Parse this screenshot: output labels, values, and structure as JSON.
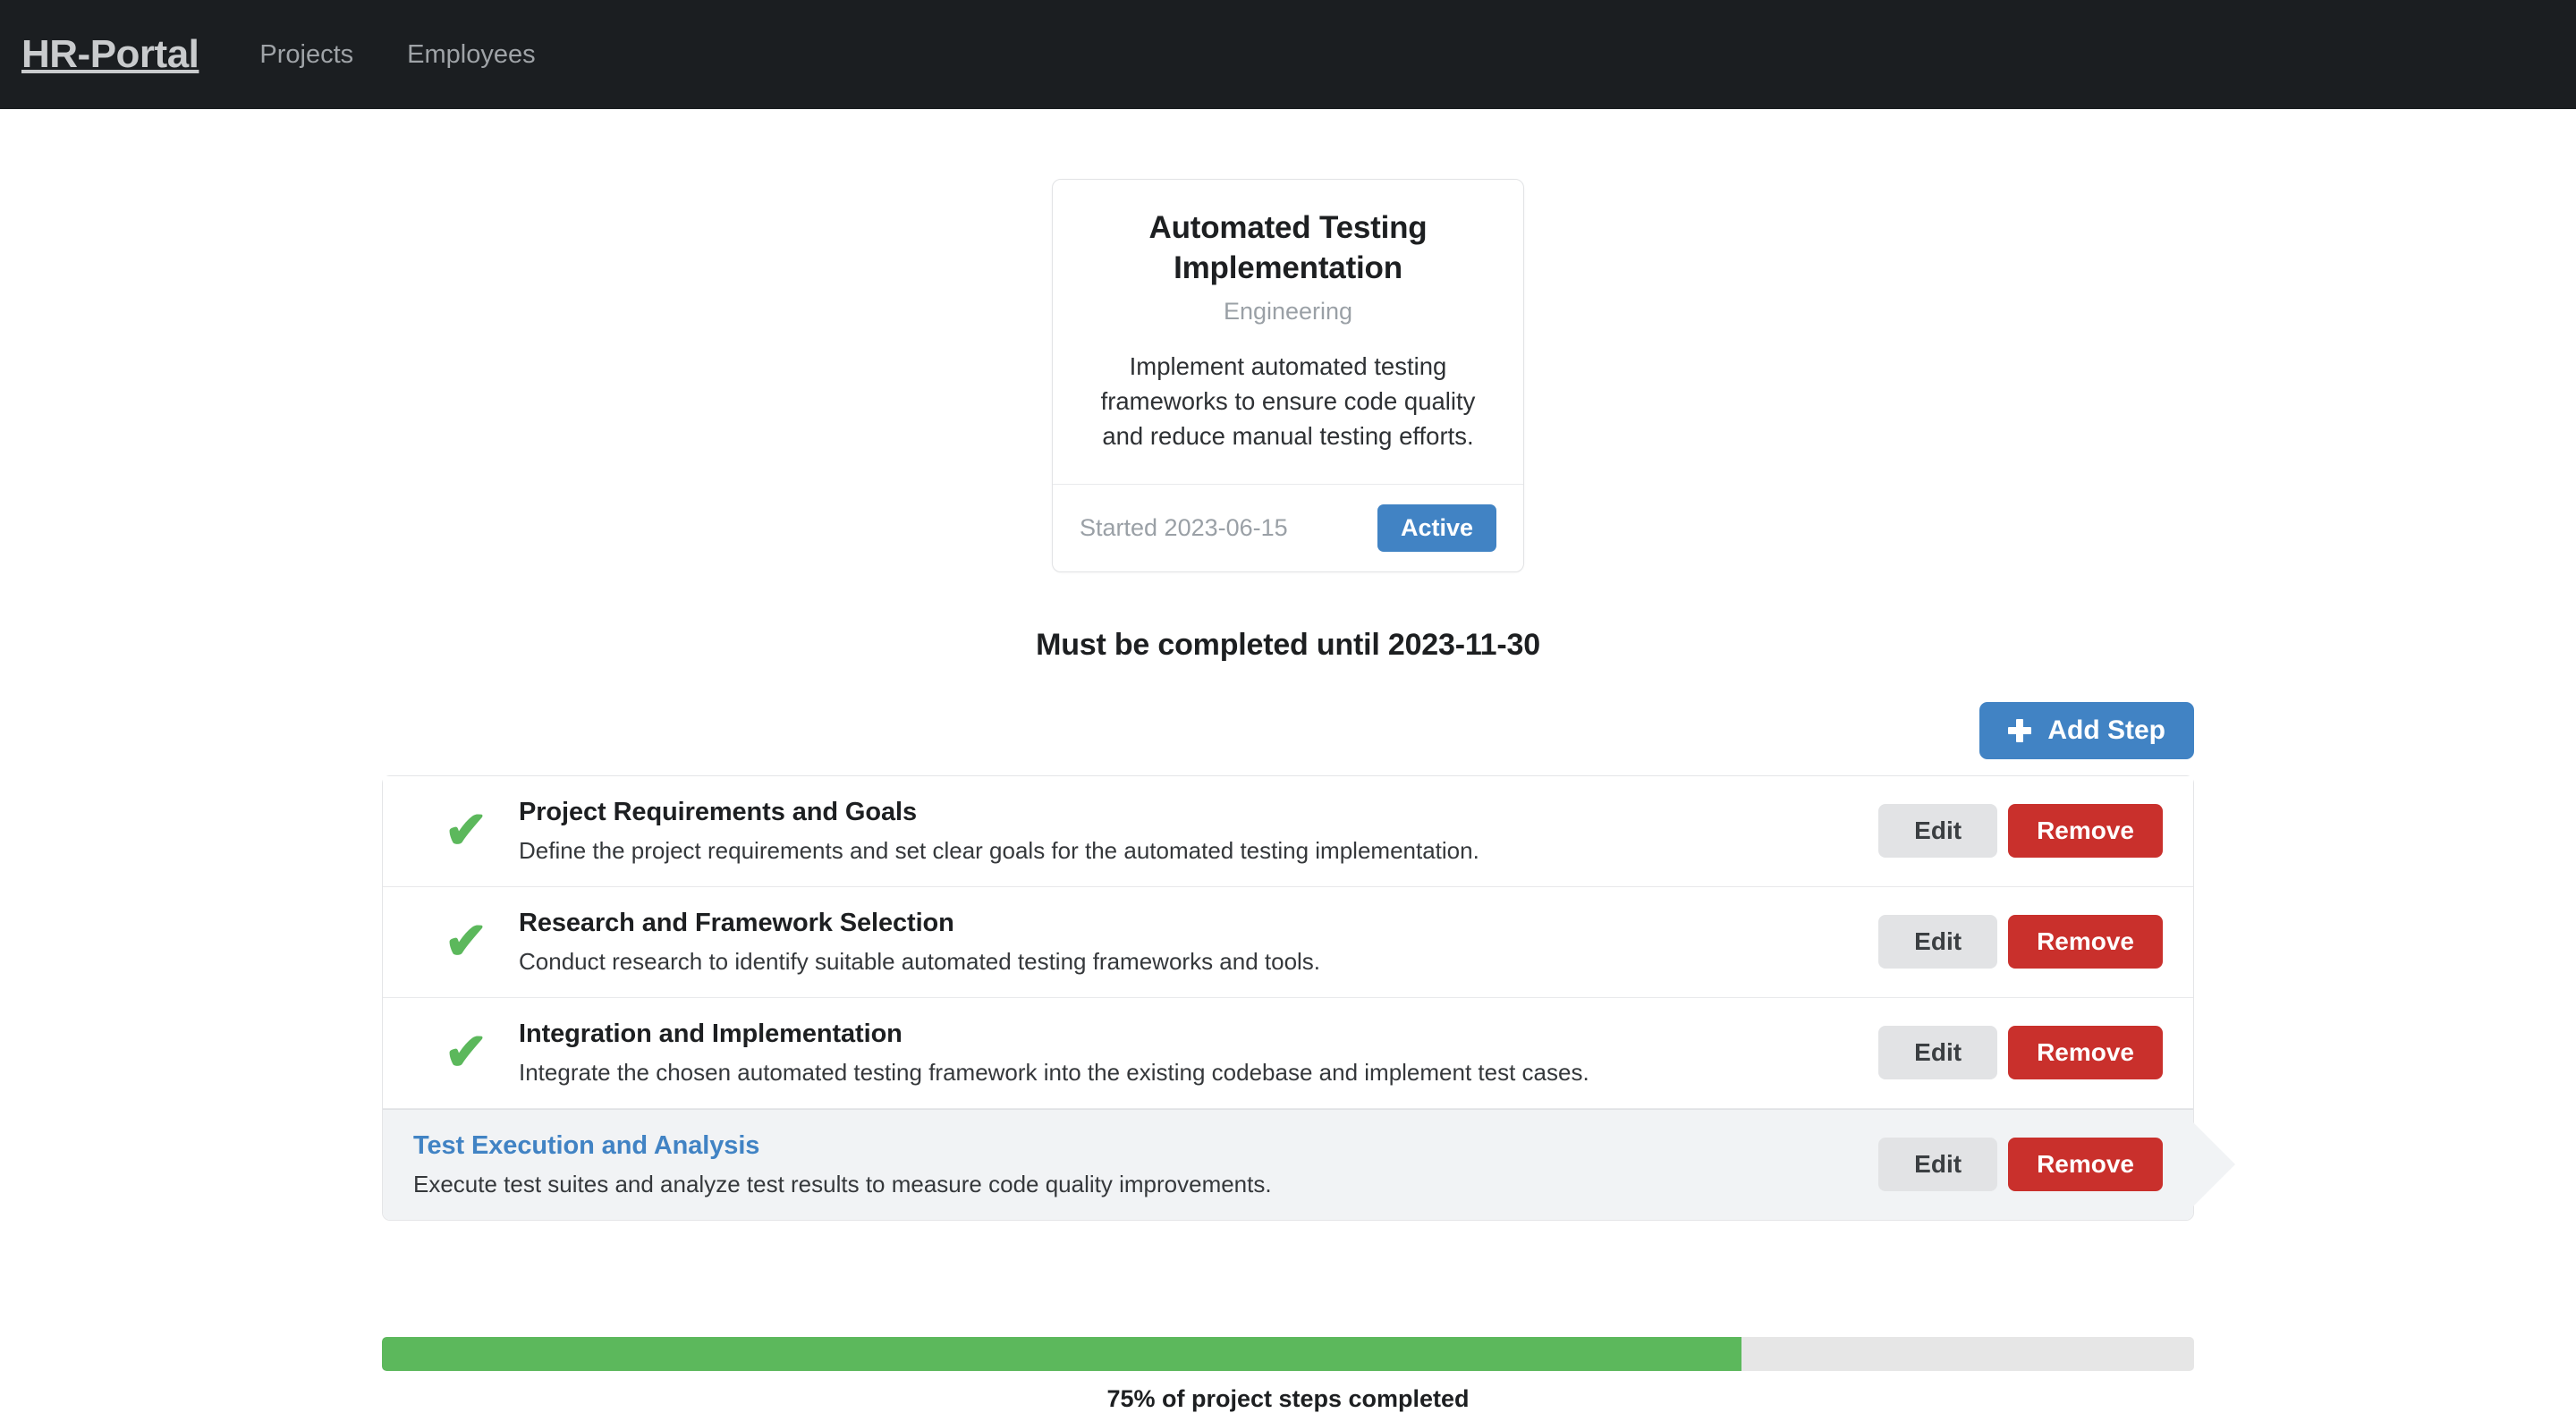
{
  "navbar": {
    "brand": "HR-Portal",
    "links": [
      {
        "label": "Projects"
      },
      {
        "label": "Employees"
      }
    ]
  },
  "project_card": {
    "title": "Automated Testing Implementation",
    "subtitle": "Engineering",
    "description": "Implement automated testing frameworks to ensure code quality and reduce manual testing efforts.",
    "started_text": "Started 2023-06-15",
    "status_label": "Active",
    "status_color": "#4183c4"
  },
  "deadline_heading": "Must be completed until 2023-11-30",
  "toolbar": {
    "add_step_label": "Add Step",
    "add_step_icon": "plus-icon"
  },
  "steps": [
    {
      "title": "Project Requirements and Goals",
      "description": "Define the project requirements and set clear goals for the automated testing implementation.",
      "completed": true,
      "icon": "check-icon",
      "edit_label": "Edit",
      "remove_label": "Remove"
    },
    {
      "title": "Research and Framework Selection",
      "description": "Conduct research to identify suitable automated testing frameworks and tools.",
      "completed": true,
      "icon": "check-icon",
      "edit_label": "Edit",
      "remove_label": "Remove"
    },
    {
      "title": "Integration and Implementation",
      "description": "Integrate the chosen automated testing framework into the existing codebase and implement test cases.",
      "completed": true,
      "icon": "check-icon",
      "edit_label": "Edit",
      "remove_label": "Remove"
    },
    {
      "title": "Test Execution and Analysis",
      "description": "Execute test suites and analyze test results to measure code quality improvements.",
      "completed": false,
      "icon": "",
      "edit_label": "Edit",
      "remove_label": "Remove"
    }
  ],
  "progress": {
    "percent": 75,
    "fill_width": "75%",
    "caption": "75% of project steps completed",
    "fill_color": "#5cb85c",
    "track_color": "#e6e6e6"
  },
  "icons": {
    "check": "✔"
  }
}
